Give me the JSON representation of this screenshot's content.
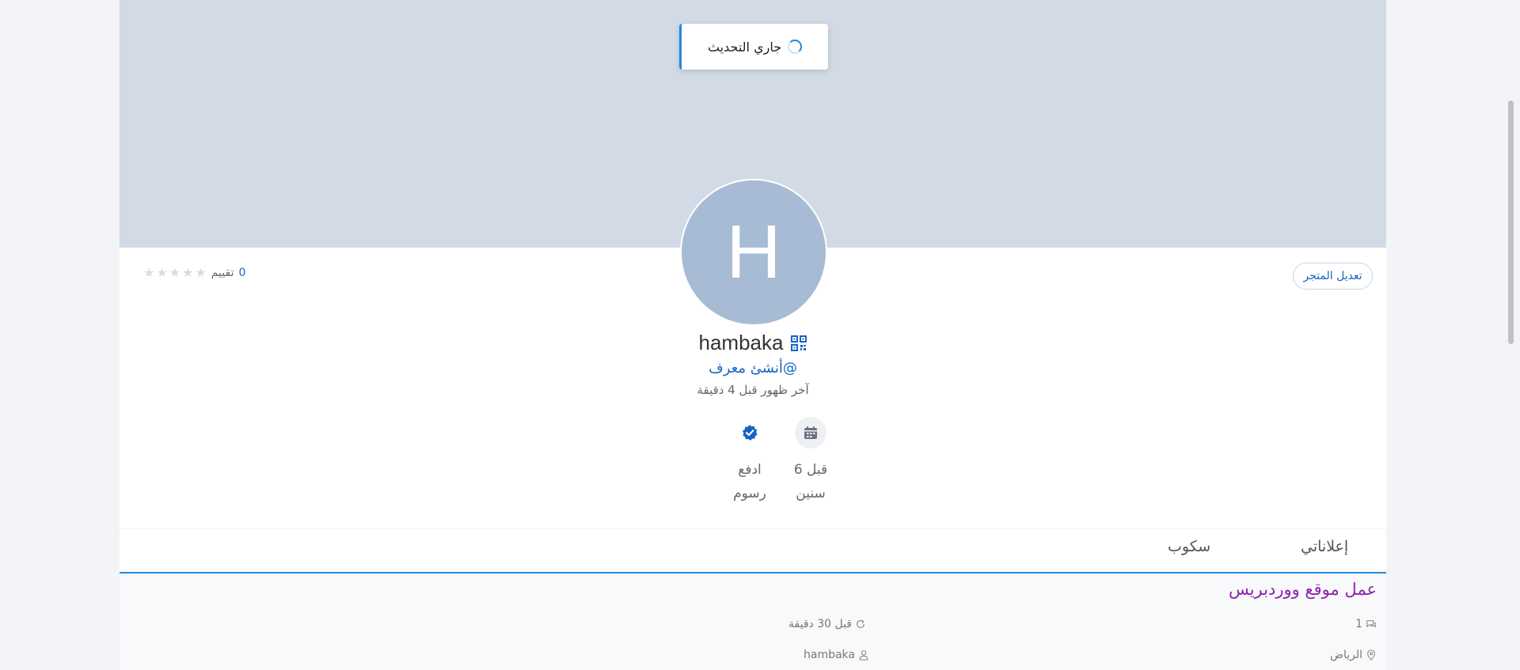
{
  "toast": {
    "text": "جاري التحديث"
  },
  "profile": {
    "avatar_letter": "H",
    "username": "hambaka",
    "handle": "@أنشئ معرف",
    "last_seen": "آخر ظهور قبل 4 دقيقة",
    "edit_store_label": "تعديل المتجر",
    "rating": {
      "count": "0",
      "label": "تقييم",
      "stars": 0,
      "max_stars": 5
    }
  },
  "stats": [
    {
      "icon": "calendar-icon",
      "line1": "قبل 6",
      "line2": "سنين"
    },
    {
      "icon": "verified-badge-icon",
      "line1": "ادفع",
      "line2": "رسوم"
    }
  ],
  "tabs": [
    {
      "label": "إعلاناتي",
      "active": true
    },
    {
      "label": "سكوب",
      "active": false
    }
  ],
  "listings": [
    {
      "title": "عمل موقع ووردبريس",
      "comments": "1",
      "time": "قبل 30 دقيقة",
      "location": "الرياض",
      "author": "hambaka"
    }
  ],
  "colors": {
    "accent": "#1e88e5",
    "link": "#1565c0",
    "title": "#8e24aa",
    "cover": "#d2dae5",
    "avatar": "#a7bbd5"
  }
}
